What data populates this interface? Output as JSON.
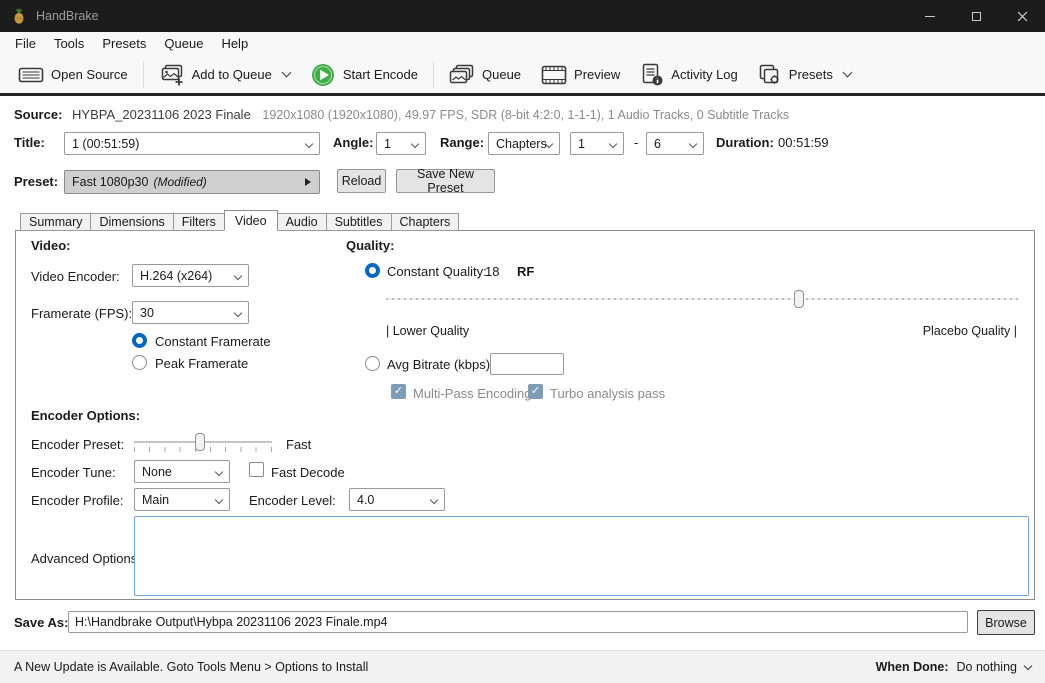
{
  "window": {
    "title": "HandBrake"
  },
  "colors": {
    "accent_blue": "#0067c0",
    "start_encode_green": "#3fae49",
    "titlebar": "#1c1c1c"
  },
  "menu": {
    "items": [
      "File",
      "Tools",
      "Presets",
      "Queue",
      "Help"
    ]
  },
  "toolbar": {
    "open_source": "Open Source",
    "add_to_queue": "Add to Queue",
    "start_encode": "Start Encode",
    "queue": "Queue",
    "preview": "Preview",
    "activity_log": "Activity Log",
    "presets": "Presets"
  },
  "source": {
    "label": "Source:",
    "name": "HYBPA_20231106 2023 Finale",
    "details": "1920x1080 (1920x1080), 49.97 FPS, SDR (8-bit 4:2:0, 1-1-1), 1 Audio Tracks, 0 Subtitle Tracks"
  },
  "title_row": {
    "title_label": "Title:",
    "title_value": "1  (00:51:59)",
    "angle_label": "Angle:",
    "angle_value": "1",
    "range_label": "Range:",
    "range_type": "Chapters",
    "range_start": "1",
    "range_sep": "-",
    "range_end": "6",
    "duration_label": "Duration:",
    "duration_value": "00:51:59"
  },
  "preset_row": {
    "label": "Preset:",
    "value": "Fast 1080p30",
    "modified": "(Modified)",
    "reload": "Reload",
    "save_new_preset": "Save New Preset"
  },
  "tabs": {
    "items": [
      "Summary",
      "Dimensions",
      "Filters",
      "Video",
      "Audio",
      "Subtitles",
      "Chapters"
    ],
    "active": "Video"
  },
  "video_tab": {
    "video_heading": "Video:",
    "encoder_label": "Video Encoder:",
    "encoder_value": "H.264 (x264)",
    "framerate_label": "Framerate (FPS):",
    "framerate_value": "30",
    "constant_framerate": "Constant Framerate",
    "peak_framerate": "Peak Framerate",
    "quality_heading": "Quality:",
    "constant_quality_label": "Constant Quality:",
    "constant_quality_value": "18",
    "rf_label": "RF",
    "lower_quality": "| Lower Quality",
    "placebo_quality": "Placebo Quality |",
    "avg_bitrate_label": "Avg Bitrate (kbps):",
    "avg_bitrate_value": "",
    "multipass": "Multi-Pass Encoding",
    "turbo": "Turbo analysis pass",
    "encoder_options_heading": "Encoder Options:",
    "encoder_preset_label": "Encoder Preset:",
    "encoder_preset_value": "Fast",
    "encoder_tune_label": "Encoder Tune:",
    "encoder_tune_value": "None",
    "fast_decode": "Fast Decode",
    "encoder_profile_label": "Encoder Profile:",
    "encoder_profile_value": "Main",
    "encoder_level_label": "Encoder Level:",
    "encoder_level_value": "4.0",
    "advanced_options_label": "Advanced Options:"
  },
  "save_as": {
    "label": "Save As:",
    "value": "H:\\Handbrake Output\\Hybpa 20231106 2023 Finale.mp4",
    "browse": "Browse"
  },
  "status_bar": {
    "update_message": "A New Update is Available. Goto Tools Menu > Options to Install",
    "when_done_label": "When Done:",
    "when_done_value": "Do nothing"
  }
}
